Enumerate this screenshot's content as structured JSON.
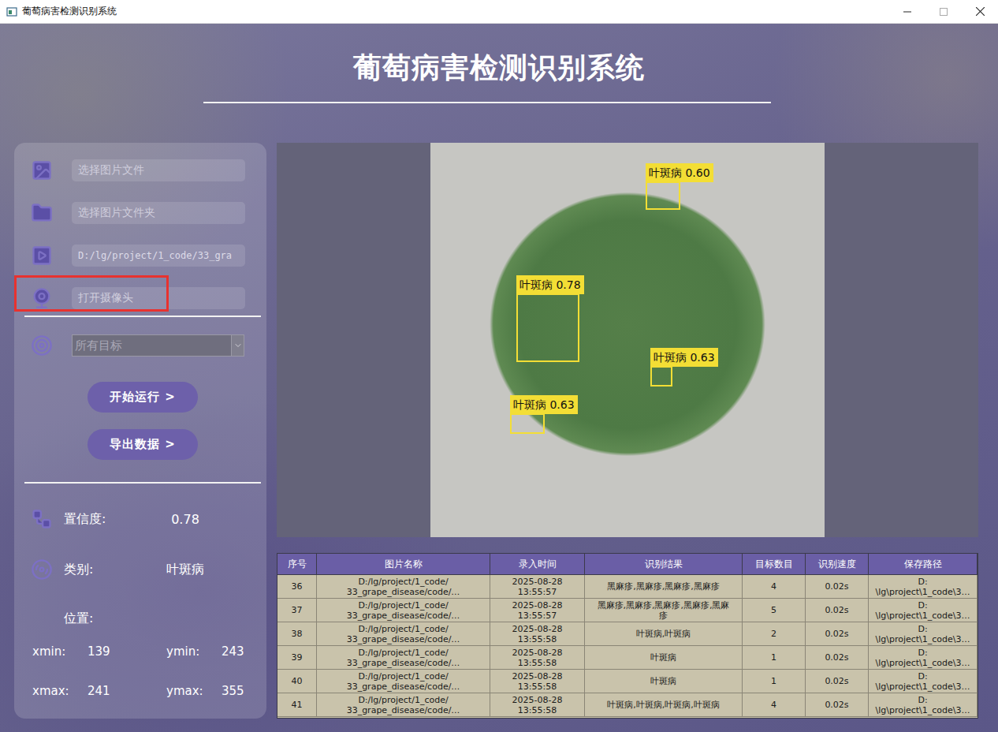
{
  "window": {
    "title": "葡萄病害检测识别系统"
  },
  "header": {
    "title": "葡萄病害检测识别系统"
  },
  "inputs": [
    {
      "kind": "image",
      "text": "选择图片文件",
      "placeholder": true,
      "highlighted": false
    },
    {
      "kind": "folder",
      "text": "选择图片文件夹",
      "placeholder": true,
      "highlighted": false
    },
    {
      "kind": "video",
      "text": "D:/lg/project/1_code/33_gra",
      "placeholder": false,
      "highlighted": false
    },
    {
      "kind": "camera",
      "text": "打开摄像头",
      "placeholder": true,
      "highlighted": true
    }
  ],
  "target_select": {
    "value": "所有目标",
    "disabled": true
  },
  "buttons": [
    "开始运行 >",
    "导出数据 >"
  ],
  "result": {
    "confidence_label": "置信度:",
    "confidence": "0.78",
    "class_label": "类别:",
    "class": "叶斑病",
    "position_label": "位置:",
    "coords": [
      {
        "label": "xmin:",
        "value": "139"
      },
      {
        "label": "ymin:",
        "value": "243"
      },
      {
        "label": "xmax:",
        "value": "241"
      },
      {
        "label": "ymax:",
        "value": "355"
      }
    ]
  },
  "detections": [
    {
      "label": "叶斑病 0.60"
    },
    {
      "label": "叶斑病 0.78"
    },
    {
      "label": "叶斑病 0.63"
    },
    {
      "label": "叶斑病 0.63"
    }
  ],
  "table": {
    "columns": [
      "序号",
      "图片名称",
      "录入时间",
      "识别结果",
      "目标数目",
      "识别速度",
      "保存路径"
    ],
    "rows": [
      {
        "index": "36",
        "name": [
          "D:/lg/project/1_code/",
          "33_grape_disease/code/…"
        ],
        "time": [
          "2025-08-28",
          "13:55:57"
        ],
        "result": [
          "黑麻疹,黑麻疹,黑麻疹,黑麻疹"
        ],
        "count": "4",
        "speed": "0.02s",
        "path": [
          "D:",
          "\\lg\\project\\1_code\\3…"
        ]
      },
      {
        "index": "37",
        "name": [
          "D:/lg/project/1_code/",
          "33_grape_disease/code/…"
        ],
        "time": [
          "2025-08-28",
          "13:55:57"
        ],
        "result": [
          "黑麻疹,黑麻疹,黑麻疹,黑麻疹,黑麻",
          "疹"
        ],
        "count": "5",
        "speed": "0.02s",
        "path": [
          "D:",
          "\\lg\\project\\1_code\\3…"
        ]
      },
      {
        "index": "38",
        "name": [
          "D:/lg/project/1_code/",
          "33_grape_disease/code/…"
        ],
        "time": [
          "2025-08-28",
          "13:55:58"
        ],
        "result": [
          "叶斑病,叶斑病"
        ],
        "count": "2",
        "speed": "0.02s",
        "path": [
          "D:",
          "\\lg\\project\\1_code\\3…"
        ]
      },
      {
        "index": "39",
        "name": [
          "D:/lg/project/1_code/",
          "33_grape_disease/code/…"
        ],
        "time": [
          "2025-08-28",
          "13:55:58"
        ],
        "result": [
          "叶斑病"
        ],
        "count": "1",
        "speed": "0.02s",
        "path": [
          "D:",
          "\\lg\\project\\1_code\\3…"
        ]
      },
      {
        "index": "40",
        "name": [
          "D:/lg/project/1_code/",
          "33_grape_disease/code/…"
        ],
        "time": [
          "2025-08-28",
          "13:55:58"
        ],
        "result": [
          "叶斑病"
        ],
        "count": "1",
        "speed": "0.02s",
        "path": [
          "D:",
          "\\lg\\project\\1_code\\3…"
        ]
      },
      {
        "index": "41",
        "name": [
          "D:/lg/project/1_code/",
          "33_grape_disease/code/…"
        ],
        "time": [
          "2025-08-28",
          "13:55:58"
        ],
        "result": [
          "叶斑病,叶斑病,叶斑病,叶斑病"
        ],
        "count": "4",
        "speed": "0.02s",
        "path": [
          "D:",
          "\\lg\\project\\1_code\\3…"
        ]
      }
    ]
  }
}
